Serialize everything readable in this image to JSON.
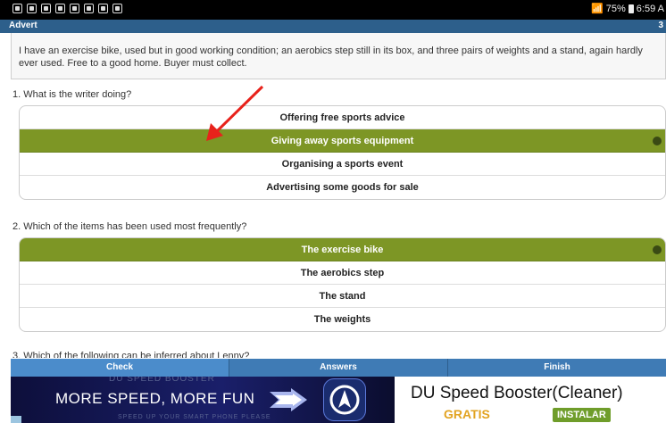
{
  "status_bar": {
    "battery": "75%",
    "time": "6:59 A"
  },
  "title_bar": {
    "title": "Advert",
    "counter": "3"
  },
  "passage": "I have an exercise bike, used but in good working condition; an aerobics step still in its box, and three pairs of weights and a stand, again hardly ever used. Free to a good home.  Buyer must collect.",
  "questions": [
    {
      "prompt": "1. What is the writer doing?",
      "options": [
        "Offering free sports advice",
        "Giving away sports equipment",
        "Organising a sports event",
        "Advertising some goods for sale"
      ],
      "selected_index": 1
    },
    {
      "prompt": "2. Which of the items has been used most frequently?",
      "options": [
        "The exercise bike",
        "The aerobics step",
        "The stand",
        "The weights"
      ],
      "selected_index": 0
    }
  ],
  "q3_partial": "3. Which of the following can be inferred about Lenny?",
  "tabs": {
    "check": "Check",
    "answers": "Answers",
    "finish": "Finish"
  },
  "ad": {
    "ghost_top": "DU SPEED BOOSTER",
    "slogan": "MORE SPEED, MORE FUN",
    "ghost_bottom": "SPEED UP YOUR SMART PHONE PLEASE",
    "title": "DU Speed Booster(Cleaner)",
    "price": "GRATIS",
    "install": "INSTALAR"
  },
  "colors": {
    "selected": "#7d9625",
    "tabbar": "#3f7bb5",
    "titlebar": "#2d5f8b",
    "annotation_arrow": "#e8221b"
  }
}
